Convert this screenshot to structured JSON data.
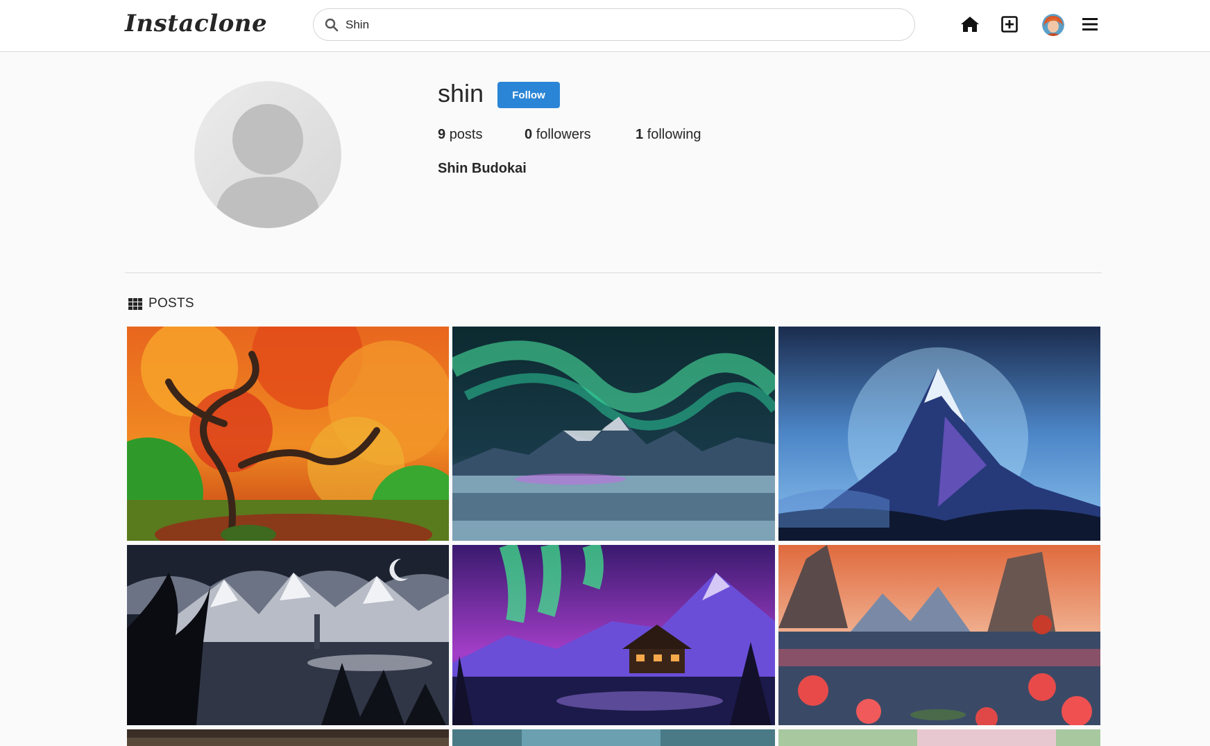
{
  "app": {
    "logo": "Instaclone"
  },
  "search": {
    "value": "Shin",
    "icon": "search-icon"
  },
  "nav": {
    "icons": [
      "home-icon",
      "add-post-icon",
      "user-avatar",
      "menu-icon"
    ]
  },
  "profile": {
    "username": "shin",
    "follow_label": "Follow",
    "posts_count": "9",
    "posts_label": "posts",
    "followers_count": "0",
    "followers_label": "followers",
    "following_count": "1",
    "following_label": "following",
    "full_name": "Shin Budokai"
  },
  "tabs": {
    "posts_label": "POSTS"
  },
  "colors": {
    "follow_button": "#2a85d6"
  },
  "posts": [
    {
      "subject": "autumn maple tree"
    },
    {
      "subject": "aurora over icy mountains"
    },
    {
      "subject": "blue mountain peak"
    },
    {
      "subject": "night forest with moon"
    },
    {
      "subject": "aurora over cabin"
    },
    {
      "subject": "lotus lake at sunset"
    },
    {
      "subject": "partial post"
    },
    {
      "subject": "partial post"
    },
    {
      "subject": "partial post"
    }
  ]
}
